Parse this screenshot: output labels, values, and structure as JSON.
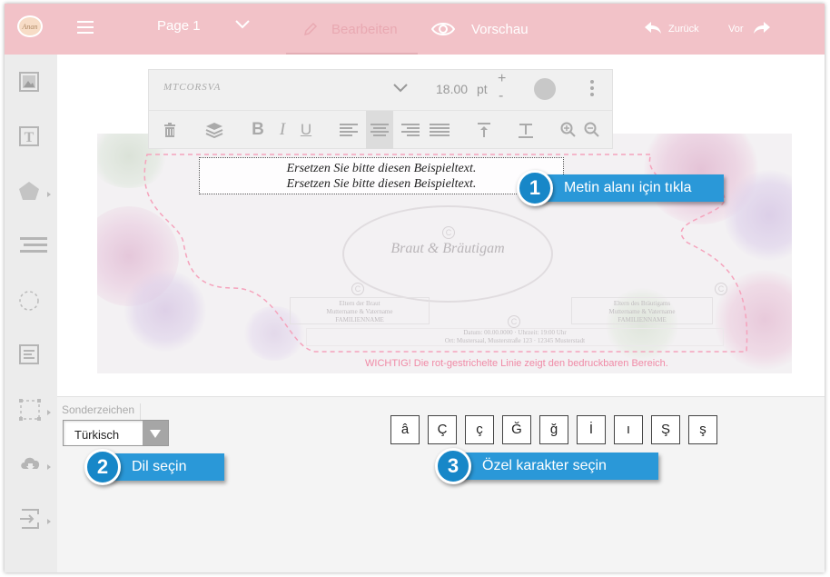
{
  "topbar": {
    "logo_text": "Anan",
    "page_label": "Page 1",
    "edit_label": "Bearbeiten",
    "preview_label": "Vorschau",
    "undo_label": "Zurück",
    "redo_label": "Vor"
  },
  "sidebar": {
    "items": [
      {
        "name": "image-tool",
        "icon": "image-icon",
        "has_submenu": false
      },
      {
        "name": "text-tool",
        "icon": "text-box-icon",
        "has_submenu": false
      },
      {
        "name": "shape-tool",
        "icon": "pentagon-icon",
        "has_submenu": true
      },
      {
        "name": "lines-tool",
        "icon": "lines-icon",
        "has_submenu": false
      },
      {
        "name": "circle-tool",
        "icon": "dashed-circle-icon",
        "has_submenu": false
      },
      {
        "name": "text-align-tool",
        "icon": "paragraph-icon",
        "has_submenu": false
      },
      {
        "name": "frame-tool",
        "icon": "dashed-frame-icon",
        "has_submenu": true
      },
      {
        "name": "upload-tool",
        "icon": "cloud-download-icon",
        "has_submenu": true
      },
      {
        "name": "export-tool",
        "icon": "export-icon",
        "has_submenu": true
      }
    ]
  },
  "toolbar": {
    "font_name": "MTCORSVA",
    "font_size": "18.00",
    "font_unit": "pt",
    "size_plus": "+",
    "size_minus": "-",
    "text_color": "#c8c8c8",
    "buttons": [
      "delete-icon",
      "layers-icon",
      "bold",
      "italic",
      "underline",
      "align-left-icon",
      "align-center-icon",
      "align-right-icon",
      "justify-icon",
      "align-top-icon",
      "text-format-icon",
      "zoom-in-icon",
      "zoom-out-icon"
    ],
    "bold_label": "B",
    "italic_label": "I",
    "underline_label": "U",
    "active_button": "align-center-icon"
  },
  "card": {
    "text_line_1": "Ersetzen Sie bitte diesen Beispieltext.",
    "text_line_2": "Ersetzen Sie bitte diesen Beispieltext.",
    "couple": "Braut & Bräutigam",
    "bride_parents": {
      "title": "Eltern der Braut",
      "names": "Muttername & Vatername",
      "family": "FAMILIENNAME"
    },
    "groom_parents": {
      "title": "Eltern des Bräutigams",
      "names": "Muttername & Vatername",
      "family": "FAMILIENNAME"
    },
    "event_line_1": "Datum: 00.00.0000 · Uhrzeit: 19:00 Uhr",
    "event_line_2": "Ort: Mustersaal, Musterstraße 123 · 12345 Musterstadt",
    "warning_text": "WICHTIG!  Die rot-gestrichelte Linie zeigt den bedruckbaren Bereich.",
    "copyright_symbol": "C"
  },
  "special_chars": {
    "title": "Sonderzeichen",
    "language": "Türkisch",
    "chars": [
      "â",
      "Ç",
      "ç",
      "Ğ",
      "ğ",
      "İ",
      "ı",
      "Ş",
      "ş"
    ]
  },
  "callouts": [
    {
      "num": "1",
      "text": "Metin alanı için tıkla"
    },
    {
      "num": "2",
      "text": "Dil seçin"
    },
    {
      "num": "3",
      "text": "Özel karakter seçin"
    }
  ],
  "colors": {
    "topbar": "#f2c2c8",
    "callout": "#2a98d8",
    "warning": "#f08aa6",
    "dashed_border": "#f5a3bc"
  }
}
